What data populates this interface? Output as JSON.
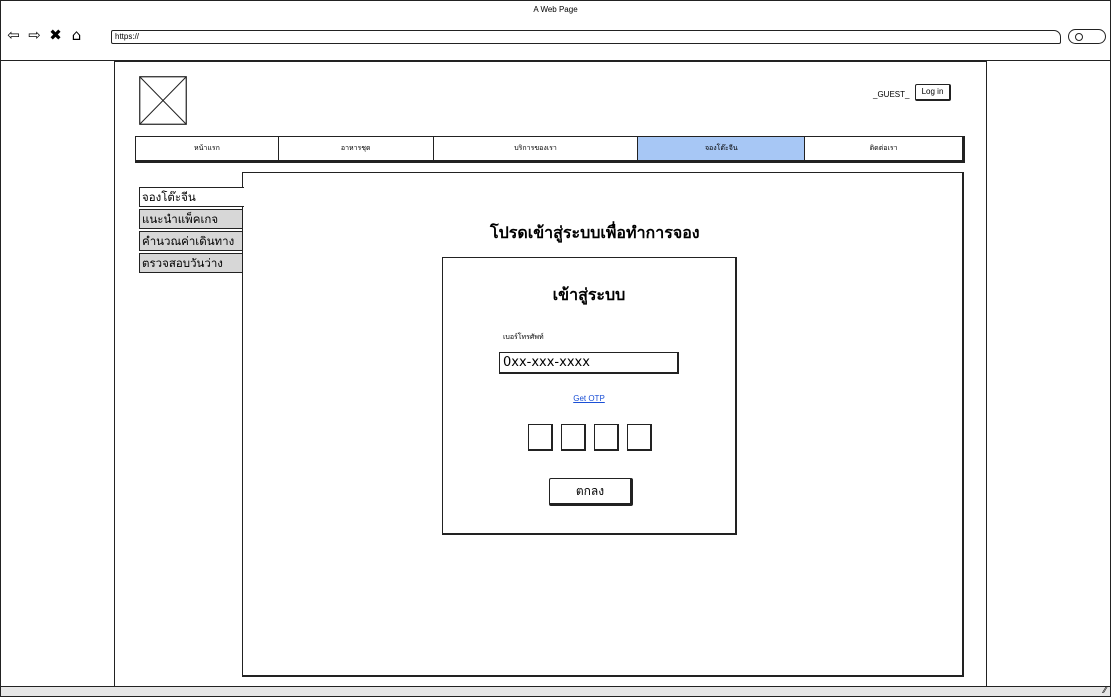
{
  "window": {
    "title": "A Web Page"
  },
  "browser": {
    "url": "https://",
    "nav_icons": [
      "back-arrow-icon",
      "forward-arrow-icon",
      "close-icon",
      "home-icon"
    ],
    "nav_glyphs": [
      "⇦",
      "⇨",
      "✖",
      "⌂"
    ]
  },
  "header": {
    "guest_label": "_GUEST_",
    "login_label": "Log in"
  },
  "menu": {
    "items": [
      {
        "label": "หน้าแรก",
        "active": false
      },
      {
        "label": "อาหารชุด",
        "active": false
      },
      {
        "label": "บริการของเรา",
        "active": false
      },
      {
        "label": "จองโต๊ะจีน",
        "active": true
      },
      {
        "label": "ติดต่อเรา",
        "active": false
      }
    ],
    "active_color": "#a7c7f5"
  },
  "sidebar": {
    "items": [
      {
        "label": "จองโต๊ะจีน",
        "active": true
      },
      {
        "label": "แนะนำแพ็คเกจ",
        "active": false
      },
      {
        "label": "คำนวณค่าเดินทาง",
        "active": false
      },
      {
        "label": "ตรวจสอบวันว่าง",
        "active": false
      }
    ]
  },
  "main": {
    "prompt": "โปรดเข้าสู่ระบบเพื่อทำการจอง",
    "login_box": {
      "title": "เข้าสู่ระบบ",
      "phone_label": "เบอร์โทรศัพท์",
      "phone_value": "0xx-xxx-xxxx",
      "otp_link": "Get OTP",
      "submit_label": "ตกลง"
    }
  }
}
